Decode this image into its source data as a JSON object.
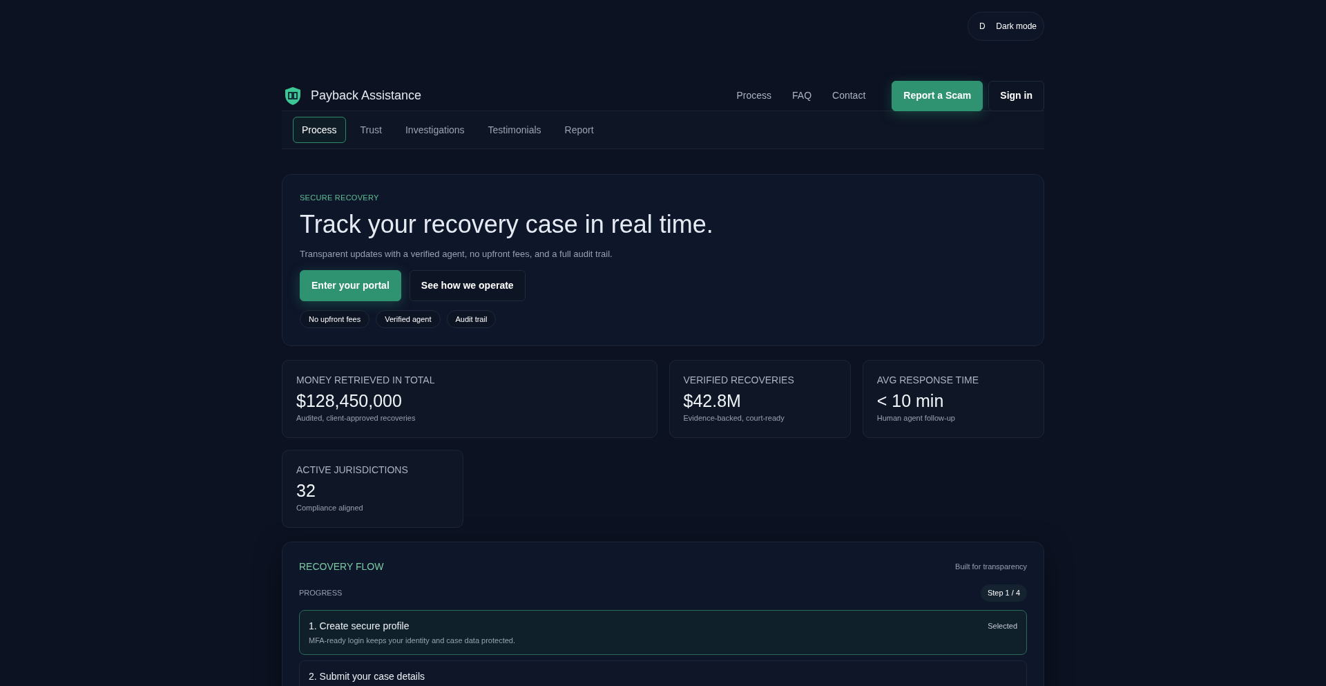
{
  "theme_toggle": {
    "initial": "D",
    "label": "Dark mode"
  },
  "header": {
    "brand": "Payback Assistance",
    "nav": [
      "Process",
      "FAQ",
      "Contact"
    ],
    "buttons": [
      {
        "label": "Report a Scam",
        "kind": "primary"
      },
      {
        "label": "Sign in",
        "kind": "secondary"
      }
    ]
  },
  "subnav": [
    {
      "label": "Process",
      "selected": true
    },
    {
      "label": "Trust",
      "selected": false
    },
    {
      "label": "Investigations",
      "selected": false
    },
    {
      "label": "Testimonials",
      "selected": false
    },
    {
      "label": "Report",
      "selected": false
    }
  ],
  "hero": {
    "eyebrow": "SECURE RECOVERY",
    "title": "Track your recovery case in real time.",
    "subtitle": "Transparent updates with a verified agent, no upfront fees, and a full audit trail.",
    "buttons": [
      {
        "label": "Enter your portal",
        "kind": "primary"
      },
      {
        "label": "See how we operate",
        "kind": "secondary"
      }
    ],
    "tags": [
      "No upfront fees",
      "Verified agent",
      "Audit trail"
    ]
  },
  "stats": [
    {
      "label": "MONEY RETRIEVED IN TOTAL",
      "value": "$128,450,000",
      "note": "Audited, client-approved recoveries"
    },
    {
      "label": "VERIFIED RECOVERIES",
      "value": "$42.8M",
      "note": "Evidence-backed, court-ready"
    },
    {
      "label": "AVG RESPONSE TIME",
      "value": "< 10 min",
      "note": "Human agent follow-up"
    },
    {
      "label": "ACTIVE JURISDICTIONS",
      "value": "32",
      "note": "Compliance aligned"
    }
  ],
  "flow": {
    "title": "RECOVERY FLOW",
    "aside": "Built for transparency",
    "progress_label": "PROGRESS",
    "step_badge": "Step 1 / 4",
    "steps": [
      {
        "title": "1. Create secure profile",
        "description": "MFA-ready login keeps your identity and case data protected.",
        "status": "Selected",
        "selected": true
      },
      {
        "title": "2. Submit your case details",
        "selected": false
      }
    ]
  }
}
